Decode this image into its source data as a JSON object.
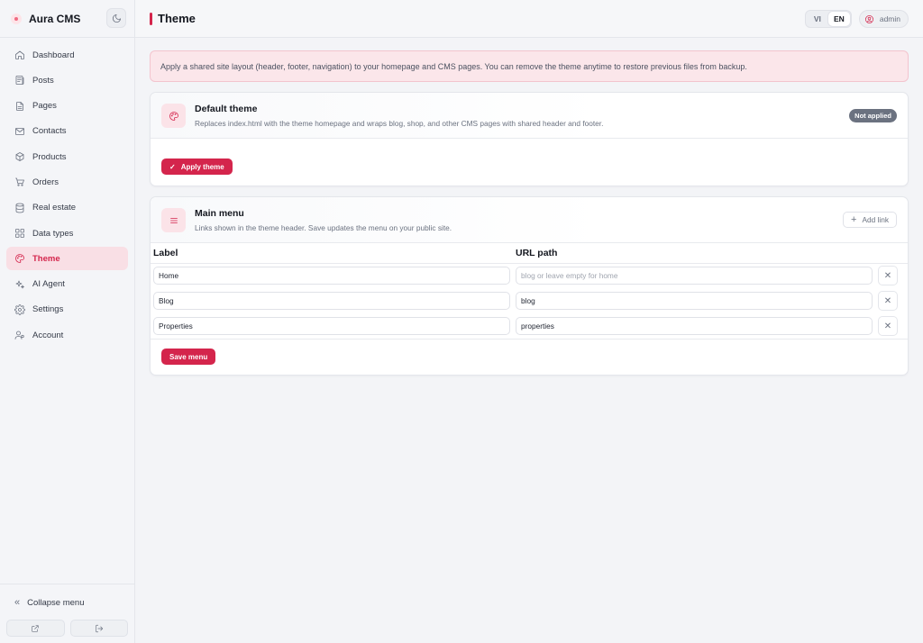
{
  "brand": {
    "name": "Aura CMS"
  },
  "sidebar": {
    "items": [
      {
        "label": "Dashboard",
        "icon": "home-icon"
      },
      {
        "label": "Posts",
        "icon": "newspaper-icon"
      },
      {
        "label": "Pages",
        "icon": "file-icon"
      },
      {
        "label": "Contacts",
        "icon": "mail-icon"
      },
      {
        "label": "Products",
        "icon": "box-icon"
      },
      {
        "label": "Orders",
        "icon": "cart-icon"
      },
      {
        "label": "Real estate",
        "icon": "database-icon"
      },
      {
        "label": "Data types",
        "icon": "grid-icon"
      },
      {
        "label": "Theme",
        "icon": "palette-icon",
        "active": true
      },
      {
        "label": "AI Agent",
        "icon": "sparkles-icon"
      },
      {
        "label": "Settings",
        "icon": "gear-icon"
      },
      {
        "label": "Account",
        "icon": "user-icon"
      }
    ],
    "collapse_label": "Collapse menu"
  },
  "header": {
    "title": "Theme",
    "lang_vi": "VI",
    "lang_en": "EN",
    "active_lang": "EN",
    "user": "admin"
  },
  "notice": "Apply a shared site layout (header, footer, navigation) to your homepage and CMS pages. You can remove the theme anytime to restore previous files from backup.",
  "default_theme": {
    "title": "Default theme",
    "description": "Replaces index.html with the theme homepage and wraps blog, shop, and other CMS pages with shared header and footer.",
    "status": "Not applied",
    "apply_label": "Apply theme"
  },
  "main_menu": {
    "title": "Main menu",
    "description": "Links shown in the theme header. Save updates the menu on your public site.",
    "add_label": "Add link",
    "col_label": "Label",
    "col_url": "URL path",
    "rows": [
      {
        "label": "Home",
        "url": "",
        "url_placeholder": "blog or leave empty for home"
      },
      {
        "label": "Blog",
        "url": "blog",
        "url_placeholder": "blog or leave empty for home"
      },
      {
        "label": "Properties",
        "url": "properties",
        "url_placeholder": "blog or leave empty for home"
      }
    ],
    "save_label": "Save menu"
  },
  "colors": {
    "accent": "#d4254c",
    "accent_soft": "#f9dfe5",
    "muted": "#6b7280"
  }
}
